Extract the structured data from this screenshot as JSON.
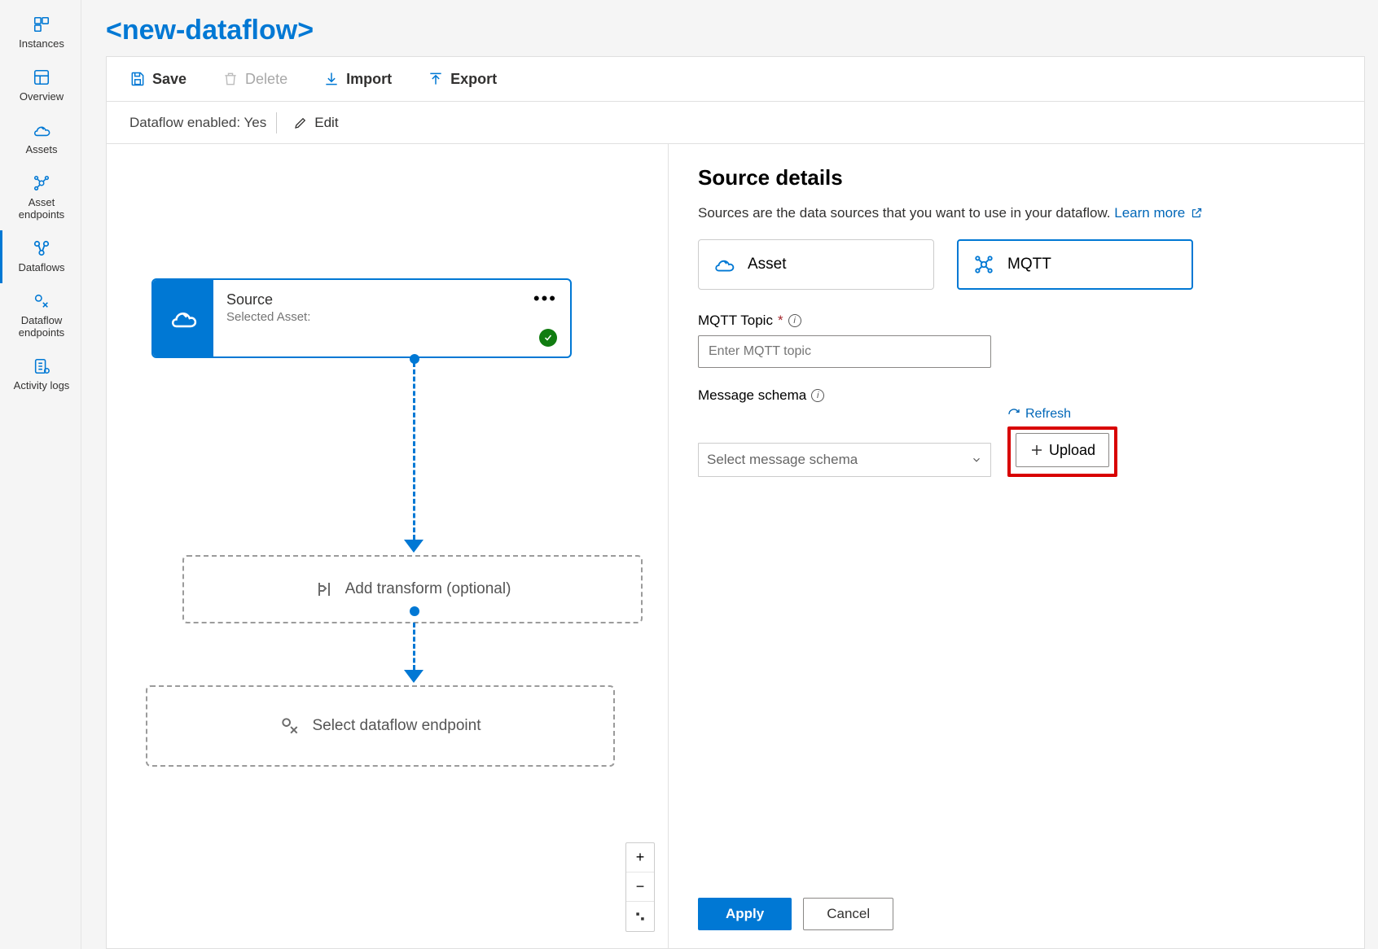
{
  "sidebar": {
    "items": [
      {
        "label": "Instances"
      },
      {
        "label": "Overview"
      },
      {
        "label": "Assets"
      },
      {
        "label": "Asset endpoints"
      },
      {
        "label": "Dataflows"
      },
      {
        "label": "Dataflow endpoints"
      },
      {
        "label": "Activity logs"
      }
    ]
  },
  "pageTitle": "<new-dataflow>",
  "toolbar": {
    "save": "Save",
    "delete": "Delete",
    "import": "Import",
    "export": "Export"
  },
  "status": {
    "enabled_text": "Dataflow enabled: Yes",
    "edit": "Edit"
  },
  "canvas": {
    "source": {
      "title": "Source",
      "sub": "Selected Asset:"
    },
    "transform": "Add transform (optional)",
    "endpoint": "Select dataflow endpoint"
  },
  "details": {
    "heading": "Source details",
    "desc": "Sources are the data sources that you want to use in your dataflow. ",
    "learn_more": "Learn more",
    "options": {
      "asset": "Asset",
      "mqtt": "MQTT"
    },
    "topic_label": "MQTT Topic",
    "topic_placeholder": "Enter MQTT topic",
    "schema_label": "Message schema",
    "schema_placeholder": "Select message schema",
    "refresh": "Refresh",
    "upload": "Upload",
    "apply": "Apply",
    "cancel": "Cancel"
  }
}
